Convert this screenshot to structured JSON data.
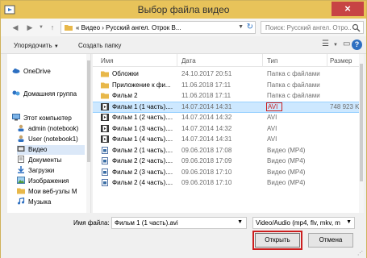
{
  "window": {
    "title": "Выбор файла видео",
    "close_label": "×"
  },
  "navbar": {
    "address": "«  Видео  ›  Русский ангел. Отрок В...",
    "search_placeholder": "Поиск: Русский ангел. Отро..."
  },
  "toolbar": {
    "organize_label": "Упорядочить",
    "new_folder_label": "Создать папку",
    "help_label": "?"
  },
  "sidebar": {
    "items": [
      {
        "label": "OneDrive"
      },
      {
        "label": "Домашняя группа"
      },
      {
        "label": "Этот компьютер"
      },
      {
        "label": "admin (notebook)"
      },
      {
        "label": "User (notebook1)"
      },
      {
        "label": "Видео"
      },
      {
        "label": "Документы"
      },
      {
        "label": "Загрузки"
      },
      {
        "label": "Изображения"
      },
      {
        "label": "Мои веб-узлы M"
      },
      {
        "label": "Музыка"
      }
    ]
  },
  "files": {
    "columns": [
      "Имя",
      "Дата",
      "Тип",
      "Размер"
    ],
    "rows": [
      {
        "name": "Обложки",
        "date": "24.10.2017 20:51",
        "type": "Папка с файлами",
        "size": "",
        "icon": "folder-icon"
      },
      {
        "name": "Приложение к фи...",
        "date": "11.06.2018 17:11",
        "type": "Папка с файлами",
        "size": "",
        "icon": "folder-icon"
      },
      {
        "name": "Фильм 2",
        "date": "11.06.2018 17:11",
        "type": "Папка с файлами",
        "size": "",
        "icon": "folder-icon"
      },
      {
        "name": "Фильм 1 (1 часть)....",
        "date": "14.07.2014 14:31",
        "type": "AVI",
        "size": "748 923 KI",
        "icon": "video-icon"
      },
      {
        "name": "Фильм 1 (2 часть)....",
        "date": "14.07.2014 14:32",
        "type": "AVI",
        "size": "",
        "icon": "video-icon"
      },
      {
        "name": "Фильм 1 (3 часть)....",
        "date": "14.07.2014 14:32",
        "type": "AVI",
        "size": "",
        "icon": "video-icon"
      },
      {
        "name": "Фильм 1 (4 часть)....",
        "date": "14.07.2014 14:31",
        "type": "AVI",
        "size": "",
        "icon": "video-icon"
      },
      {
        "name": "Фильм 2 (1 часть)....",
        "date": "09.06.2018 17:08",
        "type": "Видео (MP4)",
        "size": "",
        "icon": "mp4-icon"
      },
      {
        "name": "Фильм 2 (2 часть)....",
        "date": "09.06.2018 17:09",
        "type": "Видео (MP4)",
        "size": "",
        "icon": "mp4-icon"
      },
      {
        "name": "Фильм 2 (3 часть)....",
        "date": "09.06.2018 17:10",
        "type": "Видео (MP4)",
        "size": "",
        "icon": "mp4-icon"
      },
      {
        "name": "Фильм 2 (4 часть)....",
        "date": "09.06.2018 17:10",
        "type": "Видео (MP4)",
        "size": "",
        "icon": "mp4-icon"
      }
    ]
  },
  "bottom": {
    "filename_label": "Имя файла:",
    "filename_value": "Фильм 1 (1 часть).avi",
    "filetype_value": "Video/Audio (mp4, flv, mkv, m",
    "open_label": "Открыть",
    "cancel_label": "Отмена"
  },
  "colors": {
    "titlebar": "#e8c35a",
    "selection": "#cde8ff",
    "highlight_red": "#cc1f1f"
  }
}
